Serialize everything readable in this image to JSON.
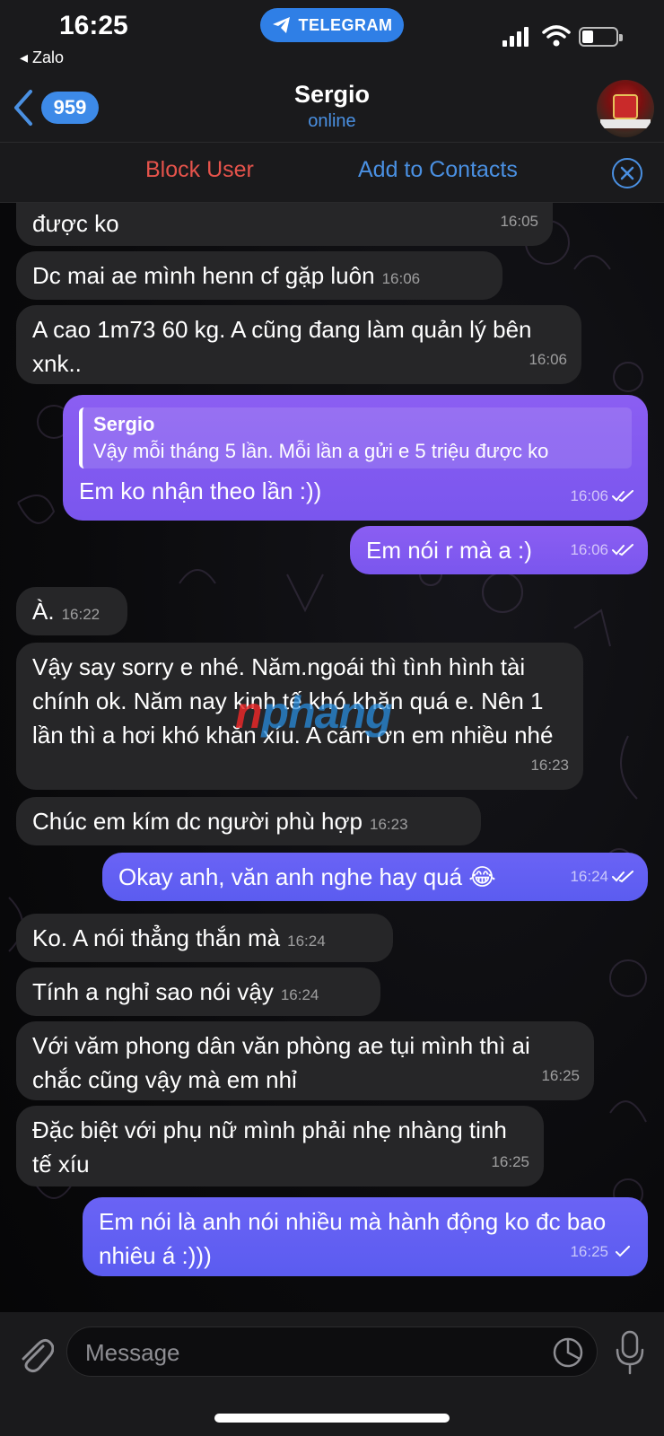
{
  "status_bar": {
    "time": "16:25",
    "back_app": "◂ Zalo",
    "pill_label": "TELEGRAM"
  },
  "header": {
    "unread_count": "959",
    "contact_name": "Sergio",
    "presence": "online"
  },
  "action_bar": {
    "block_label": "Block User",
    "add_label": "Add to Contacts"
  },
  "watermark": {
    "first": "n",
    "rest": "phang"
  },
  "messages": [
    {
      "text": "được ko",
      "time": "16:05",
      "dir": "in"
    },
    {
      "text": "Dc mai ae mình henn cf gặp luôn",
      "time": "16:06",
      "dir": "in"
    },
    {
      "text": "A cao 1m73 60 kg. A cũng đang làm quản lý bên xnk..",
      "time": "16:06",
      "dir": "in"
    },
    {
      "reply_name": "Sergio",
      "reply_text": "Vậy mỗi tháng 5 lần. Mỗi lần a gửi e 5 triệu được ko",
      "text": "Em ko nhận theo lần :))",
      "time": "16:06",
      "dir": "out"
    },
    {
      "text": "Em nói r mà a :)",
      "time": "16:06",
      "dir": "out"
    },
    {
      "text": "À.",
      "time": "16:22",
      "dir": "in"
    },
    {
      "text": "Vậy say sorry e nhé. Năm.ngoái thì tình hình tài chính ok. Năm nay kinh tế khó khăn quá e. Nên 1 lần thì a hơi khó khăn xíu. A cảm ơn em nhiều nhé",
      "time": "16:23",
      "dir": "in"
    },
    {
      "text": "Chúc em kím dc người phù hợp",
      "time": "16:23",
      "dir": "in"
    },
    {
      "text": "Okay anh, văn anh nghe hay quá 😂",
      "time": "16:24",
      "dir": "out"
    },
    {
      "text": "Ko. A nói thẳng thắn mà",
      "time": "16:24",
      "dir": "in"
    },
    {
      "text": "Tính a nghỉ sao nói vậy",
      "time": "16:24",
      "dir": "in"
    },
    {
      "text": "Với văm phong dân văn phòng ae tụi mình thì ai chắc cũng vậy mà em nhỉ",
      "time": "16:25",
      "dir": "in"
    },
    {
      "text": "Đặc biệt với phụ nữ mình phải nhẹ nhàng tinh tế xíu",
      "time": "16:25",
      "dir": "in"
    },
    {
      "text": "Em nói là anh nói nhiều mà hành động ko đc bao nhiêu á :)))",
      "time": "16:25",
      "dir": "out"
    }
  ],
  "composer": {
    "placeholder": "Message"
  }
}
